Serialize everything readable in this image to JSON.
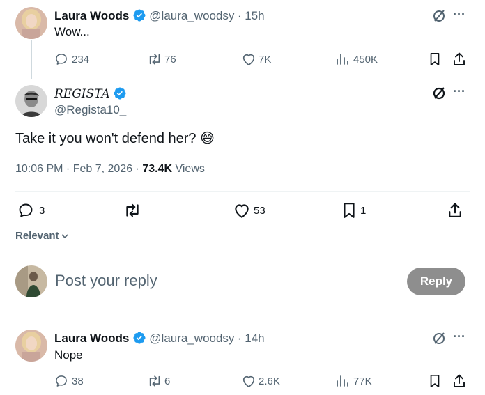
{
  "tweet1": {
    "name": "Laura Woods",
    "handle": "@laura_woodsy",
    "time": "· 15h",
    "text": "Wow...",
    "stats": {
      "replies": "234",
      "reposts": "76",
      "likes": "7K",
      "views": "450K"
    }
  },
  "main_tweet": {
    "name": "REGISTA",
    "handle": "@Regista10_",
    "text": "Take it you won't defend her?",
    "emoji": "😅",
    "timestamp": "10:06 PM · Feb 7, 2026 · ",
    "views_count": "73.4K",
    "views_label": " Views",
    "stats": {
      "replies": "3",
      "likes": "53",
      "bookmarks": "1"
    }
  },
  "sort": {
    "label": "Relevant"
  },
  "composer": {
    "placeholder": "Post your reply",
    "button_label": "Reply"
  },
  "tweet2": {
    "name": "Laura Woods",
    "handle": "@laura_woodsy",
    "time": "· 14h",
    "text": "Nope",
    "stats": {
      "replies": "38",
      "reposts": "6",
      "likes": "2.6K",
      "views": "77K"
    }
  },
  "more_label": "···",
  "colors": {
    "verified": "#1d9bf0",
    "text": "#0f1419",
    "muted": "#536471",
    "reply_button": "#8e8e8e"
  }
}
